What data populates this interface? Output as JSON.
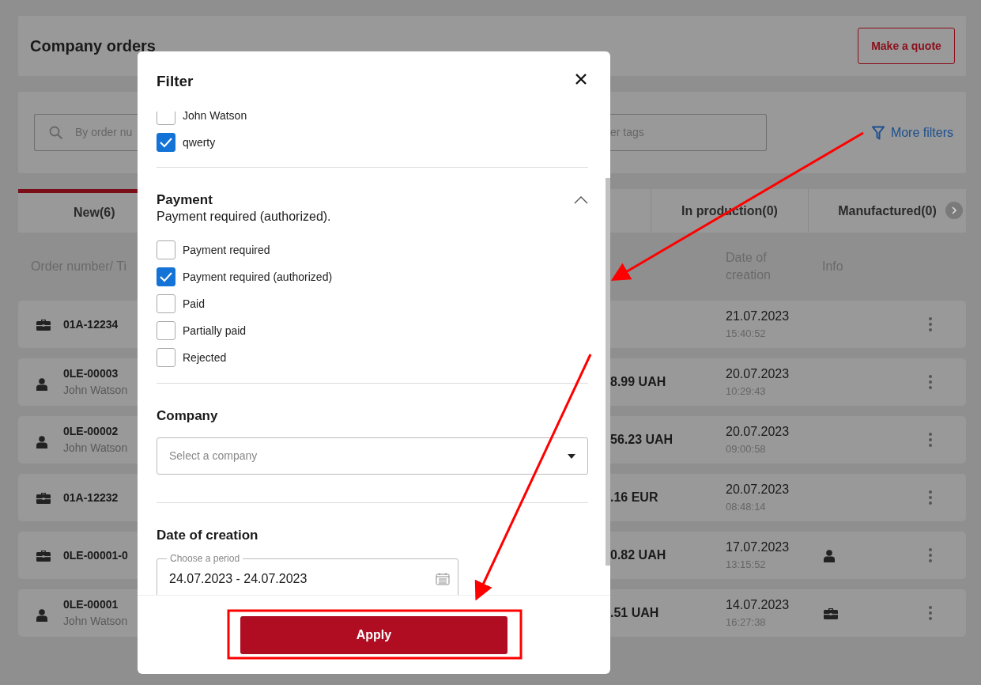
{
  "page": {
    "title": "Company orders",
    "quote_button": "Make a quote",
    "search": {
      "placeholder": "By order nu"
    },
    "tags_field": {
      "placeholder": "er tags"
    },
    "more_filters": "More filters",
    "tabs": [
      {
        "label": "New(6)",
        "selected": true
      },
      {
        "label": "In production(0)",
        "selected": false
      },
      {
        "label": "Manufactured(0)",
        "selected": false
      }
    ],
    "columns": [
      "Order number/ Ti",
      "Date of creation",
      "Info"
    ],
    "rows": [
      {
        "kind": "company",
        "number": "01A-12234",
        "date": "21.07.2023",
        "time": "15:40:52"
      },
      {
        "kind": "person",
        "number": "0LE-00003",
        "customer": "John Watson",
        "amount": "8.99 UAH",
        "date": "20.07.2023",
        "time": "10:29:43"
      },
      {
        "kind": "person",
        "number": "0LE-00002",
        "customer": "John Watson",
        "amount": "56.23 UAH",
        "date": "20.07.2023",
        "time": "09:00:58"
      },
      {
        "kind": "company",
        "number": "01A-12232",
        "amount": ".16 EUR",
        "date": "20.07.2023",
        "time": "08:48:14"
      },
      {
        "kind": "company",
        "number": "0LE-00001-0",
        "amount": "0.82 UAH",
        "date": "17.07.2023",
        "time": "13:15:52",
        "info": {
          "kind": "person"
        }
      },
      {
        "kind": "person",
        "number": "0LE-00001",
        "customer": "John Watson",
        "amount": ".51 UAH",
        "date": "14.07.2023",
        "time": "16:27:38",
        "info": {
          "kind": "company"
        }
      }
    ]
  },
  "modal": {
    "title": "Filter",
    "sections": [
      {
        "kind": "checklist",
        "options": [
          {
            "label": "John Watson",
            "checked": false
          },
          {
            "label": "qwerty",
            "checked": true
          }
        ]
      },
      {
        "kind": "checklist",
        "heading": "Payment",
        "summary": "Payment required (authorized).",
        "expanded": true,
        "options": [
          {
            "label": "Payment required",
            "checked": false
          },
          {
            "label": "Payment required (authorized)",
            "checked": true
          },
          {
            "label": "Paid",
            "checked": false
          },
          {
            "label": "Partially paid",
            "checked": false
          },
          {
            "label": "Rejected",
            "checked": false
          }
        ]
      },
      {
        "kind": "select",
        "heading": "Company",
        "placeholder": "Select a company"
      },
      {
        "kind": "period",
        "heading": "Date of creation",
        "label": "Choose a period",
        "value": "24.07.2023 - 24.07.2023"
      }
    ],
    "apply": "Apply"
  }
}
